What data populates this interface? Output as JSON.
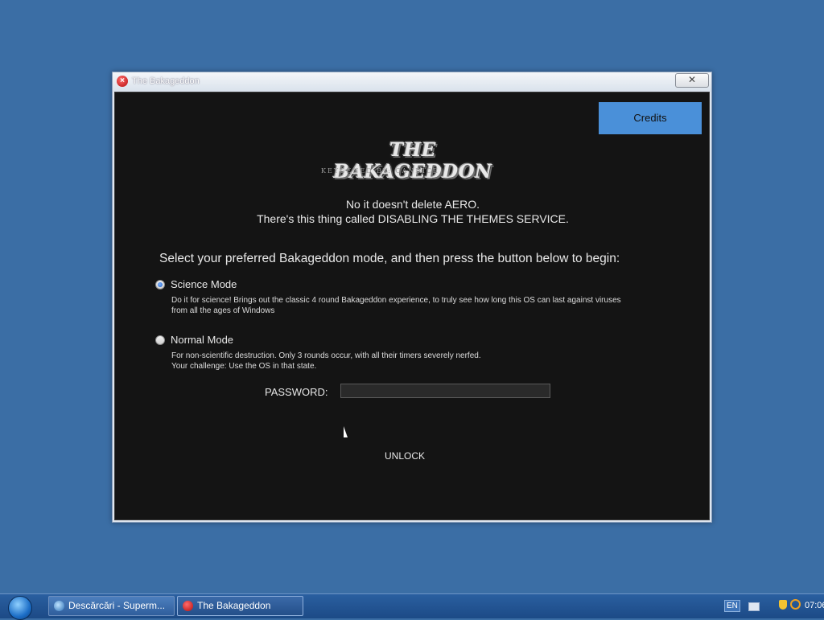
{
  "window": {
    "title": "The Bakageddon",
    "close_glyph": "✕"
  },
  "app": {
    "credits_label": "Credits",
    "logo_title": "THE BAKAGEDDON",
    "logo_subtitle": "KEYGENED BY: CANDICE",
    "notice_line1": "No it doesn't delete AERO.",
    "notice_line2": "There's this thing called DISABLING THE THEMES SERVICE.",
    "prompt": "Select your preferred Bakageddon mode, and then press the button below to begin:",
    "modes": [
      {
        "label": "Science Mode",
        "checked": true,
        "desc_line1": "Do it for science! Brings out the classic 4 round Bakageddon experience, to truly see how long this OS can last against viruses",
        "desc_line2": "from all the ages of Windows"
      },
      {
        "label": "Normal Mode",
        "checked": false,
        "desc_line1": "For non-scientific destruction. Only 3 rounds occur, with all their timers severely nerfed.",
        "desc_line2": "Your challenge: Use the OS in that state."
      }
    ],
    "password_label": "PASSWORD:",
    "password_value": "",
    "unlock_label": "UNLOCK"
  },
  "taskbar": {
    "tasks": [
      {
        "label": "Descărcări - Superm...",
        "icon": "browser-icon",
        "active": false
      },
      {
        "label": "The Bakageddon",
        "icon": "bakageddon-icon",
        "active": true
      }
    ],
    "tray": {
      "language": "EN",
      "clock": "07:06"
    }
  },
  "colors": {
    "desktop": "#3b6ea5",
    "client_bg": "#141414",
    "credits_bg": "#4a90d9"
  }
}
